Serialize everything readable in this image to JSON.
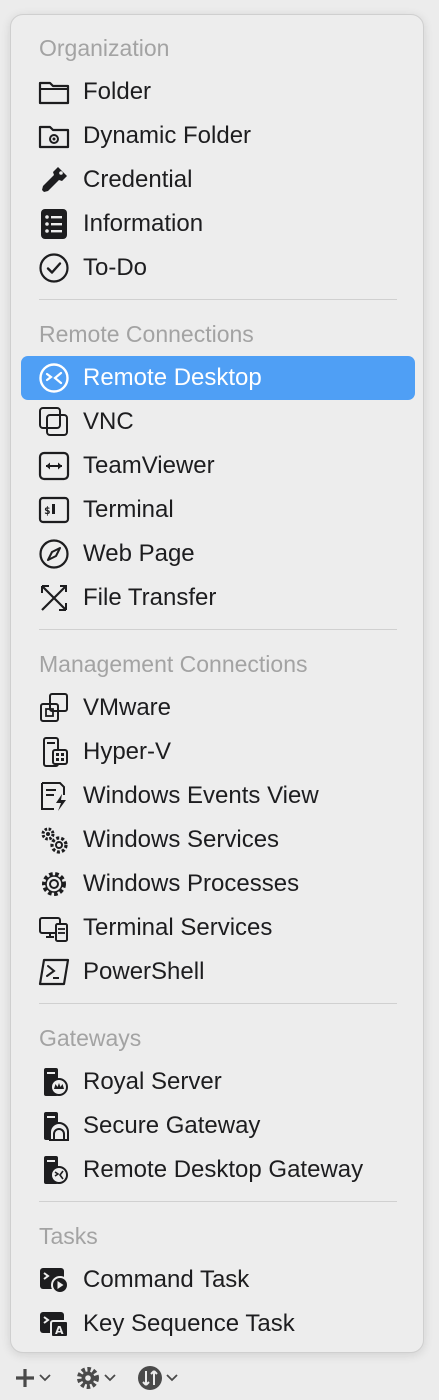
{
  "menu": {
    "sections": [
      {
        "header": "Organization",
        "items": [
          {
            "label": "Folder",
            "icon": "folder-icon"
          },
          {
            "label": "Dynamic Folder",
            "icon": "dynamic-folder-icon"
          },
          {
            "label": "Credential",
            "icon": "key-icon"
          },
          {
            "label": "Information",
            "icon": "information-icon"
          },
          {
            "label": "To-Do",
            "icon": "checkmark-circle-icon"
          }
        ]
      },
      {
        "header": "Remote Connections",
        "items": [
          {
            "label": "Remote Desktop",
            "icon": "remote-desktop-icon",
            "selected": true
          },
          {
            "label": "VNC",
            "icon": "vnc-icon"
          },
          {
            "label": "TeamViewer",
            "icon": "teamviewer-icon"
          },
          {
            "label": "Terminal",
            "icon": "terminal-icon"
          },
          {
            "label": "Web Page",
            "icon": "compass-icon"
          },
          {
            "label": "File Transfer",
            "icon": "file-transfer-icon"
          }
        ]
      },
      {
        "header": "Management Connections",
        "items": [
          {
            "label": "VMware",
            "icon": "vmware-icon"
          },
          {
            "label": "Hyper-V",
            "icon": "hyper-v-icon"
          },
          {
            "label": "Windows Events View",
            "icon": "events-view-icon"
          },
          {
            "label": "Windows Services",
            "icon": "gears-icon"
          },
          {
            "label": "Windows Processes",
            "icon": "gear-icon"
          },
          {
            "label": "Terminal Services",
            "icon": "terminal-services-icon"
          },
          {
            "label": "PowerShell",
            "icon": "powershell-icon"
          }
        ]
      },
      {
        "header": "Gateways",
        "items": [
          {
            "label": "Royal Server",
            "icon": "royal-server-icon"
          },
          {
            "label": "Secure Gateway",
            "icon": "secure-gateway-icon"
          },
          {
            "label": "Remote Desktop Gateway",
            "icon": "rd-gateway-icon"
          }
        ]
      },
      {
        "header": "Tasks",
        "items": [
          {
            "label": "Command Task",
            "icon": "command-task-icon"
          },
          {
            "label": "Key Sequence Task",
            "icon": "key-sequence-task-icon"
          }
        ]
      }
    ]
  },
  "toolbar": {
    "buttons": [
      {
        "icon": "plus-icon"
      },
      {
        "icon": "gear-icon"
      },
      {
        "icon": "connect-icon"
      }
    ]
  },
  "colors": {
    "selected_background": "#4f9ff5",
    "header_text": "#a3a3a3",
    "item_text": "#1d1d1f"
  }
}
